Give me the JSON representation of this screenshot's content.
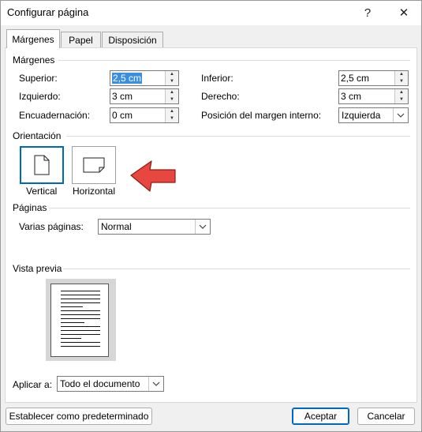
{
  "window": {
    "title": "Configurar página",
    "help_glyph": "?",
    "close_glyph": "✕"
  },
  "tabs": [
    {
      "label": "Márgenes",
      "active": true
    },
    {
      "label": "Papel",
      "active": false
    },
    {
      "label": "Disposición",
      "active": false
    }
  ],
  "margins": {
    "group_label": "Márgenes",
    "superior": {
      "label": "Superior:",
      "value": "2,5 cm"
    },
    "inferior": {
      "label": "Inferior:",
      "value": "2,5 cm"
    },
    "izquierdo": {
      "label": "Izquierdo:",
      "value": "3 cm"
    },
    "derecho": {
      "label": "Derecho:",
      "value": "3 cm"
    },
    "encuadernacion": {
      "label": "Encuadernación:",
      "value": "0 cm"
    },
    "posicion": {
      "label": "Posición del margen interno:",
      "value": "Izquierda"
    }
  },
  "orientation": {
    "group_label": "Orientación",
    "vertical_label": "Vertical",
    "horizontal_label": "Horizontal",
    "selected": "vertical"
  },
  "pages": {
    "group_label": "Páginas",
    "multiple_label": "Varias páginas:",
    "multiple_value": "Normal"
  },
  "preview": {
    "group_label": "Vista previa"
  },
  "apply": {
    "label": "Aplicar a:",
    "value": "Todo el documento"
  },
  "buttons": {
    "default_label": "Establecer como predeterminado",
    "ok_label": "Aceptar",
    "cancel_label": "Cancelar"
  },
  "colors": {
    "accent": "#0067c0",
    "annotation_arrow": "#e8473f",
    "selection": "#3b8fe0"
  }
}
